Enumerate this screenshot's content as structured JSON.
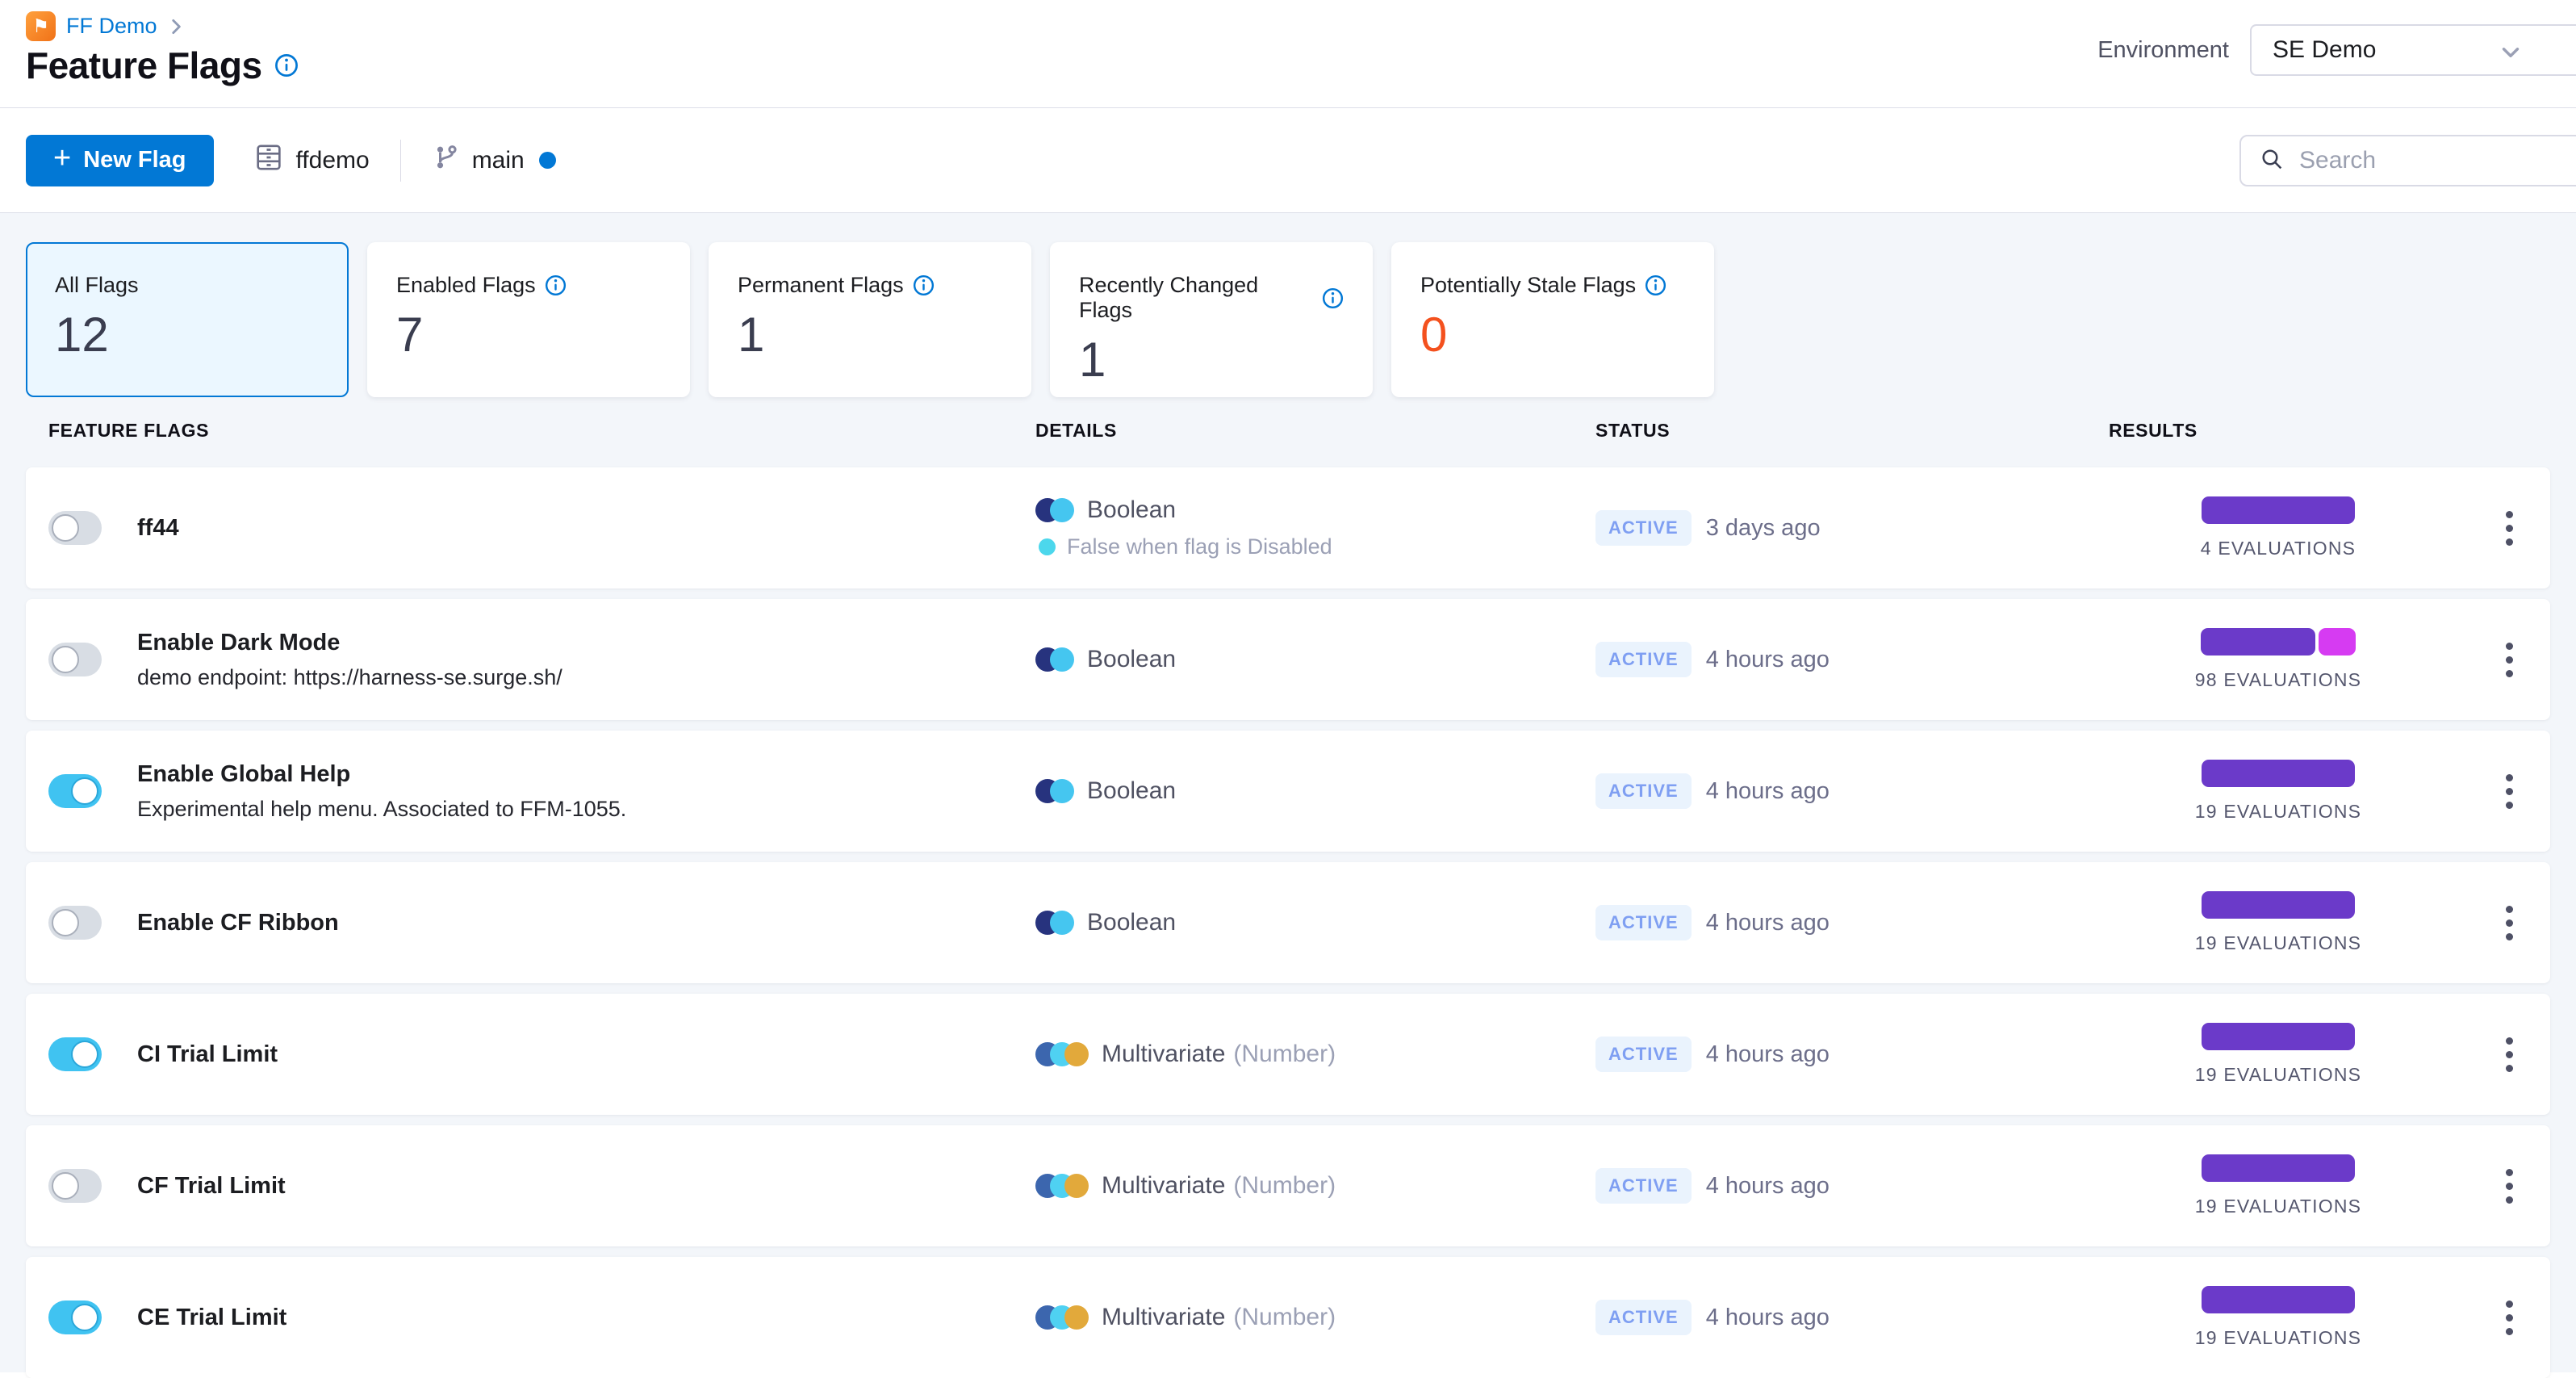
{
  "header": {
    "breadcrumb_label": "FF Demo",
    "title": "Feature Flags",
    "environment_label": "Environment",
    "environment_value": "SE Demo"
  },
  "toolbar": {
    "new_flag_plus": "+",
    "new_flag_label": "New Flag",
    "repository_name": "ffdemo",
    "branch_name": "main",
    "search_placeholder": "Search"
  },
  "summary_cards": [
    {
      "label": "All Flags",
      "value": "12",
      "info": false,
      "selected": true
    },
    {
      "label": "Enabled Flags",
      "value": "7",
      "info": true,
      "selected": false
    },
    {
      "label": "Permanent Flags",
      "value": "1",
      "info": true,
      "selected": false
    },
    {
      "label": "Recently Changed Flags",
      "value": "1",
      "info": true,
      "selected": false
    },
    {
      "label": "Potentially Stale Flags",
      "value": "0",
      "info": true,
      "selected": false,
      "value_color": "#F4511E"
    }
  ],
  "table": {
    "headers": [
      "FEATURE FLAGS",
      "DETAILS",
      "STATUS",
      "RESULTS"
    ],
    "rows": [
      {
        "name": "ff44",
        "description": "",
        "toggle": "off",
        "type_label": "Boolean",
        "type_kind": "boolean",
        "type_note": "",
        "variation_note": "False when flag is Disabled",
        "status": "ACTIVE",
        "updated": "3 days ago",
        "evaluations_label": "4 EVALUATIONS",
        "bar_segments": [
          {
            "color": "#6B3AC9",
            "width": 190
          }
        ]
      },
      {
        "name": "Enable Dark Mode",
        "description": "demo endpoint: https://harness-se.surge.sh/",
        "toggle": "off",
        "type_label": "Boolean",
        "type_kind": "boolean",
        "type_note": "",
        "variation_note": "",
        "status": "ACTIVE",
        "updated": "4 hours ago",
        "evaluations_label": "98 EVALUATIONS",
        "bar_segments": [
          {
            "color": "#6B3AC9",
            "width": 142
          },
          {
            "color": "#D63BF2",
            "width": 46
          }
        ]
      },
      {
        "name": "Enable Global Help",
        "description": "Experimental help menu. Associated to FFM-1055.",
        "toggle": "on",
        "type_label": "Boolean",
        "type_kind": "boolean",
        "type_note": "",
        "variation_note": "",
        "status": "ACTIVE",
        "updated": "4 hours ago",
        "evaluations_label": "19 EVALUATIONS",
        "bar_segments": [
          {
            "color": "#6B3AC9",
            "width": 190
          }
        ]
      },
      {
        "name": "Enable CF Ribbon",
        "description": "",
        "toggle": "off",
        "type_label": "Boolean",
        "type_kind": "boolean",
        "type_note": "",
        "variation_note": "",
        "status": "ACTIVE",
        "updated": "4 hours ago",
        "evaluations_label": "19 EVALUATIONS",
        "bar_segments": [
          {
            "color": "#6B3AC9",
            "width": 190
          }
        ]
      },
      {
        "name": "CI Trial Limit",
        "description": "",
        "toggle": "on",
        "type_label": "Multivariate",
        "type_kind": "multivariate",
        "type_note": "(Number)",
        "variation_note": "",
        "status": "ACTIVE",
        "updated": "4 hours ago",
        "evaluations_label": "19 EVALUATIONS",
        "bar_segments": [
          {
            "color": "#6B3AC9",
            "width": 190
          }
        ]
      },
      {
        "name": "CF Trial Limit",
        "description": "",
        "toggle": "off",
        "type_label": "Multivariate",
        "type_kind": "multivariate",
        "type_note": "(Number)",
        "variation_note": "",
        "status": "ACTIVE",
        "updated": "4 hours ago",
        "evaluations_label": "19 EVALUATIONS",
        "bar_segments": [
          {
            "color": "#6B3AC9",
            "width": 190
          }
        ]
      },
      {
        "name": "CE Trial Limit",
        "description": "",
        "toggle": "on",
        "type_label": "Multivariate",
        "type_kind": "multivariate",
        "type_note": "(Number)",
        "variation_note": "",
        "status": "ACTIVE",
        "updated": "4 hours ago",
        "evaluations_label": "19 EVALUATIONS",
        "bar_segments": [
          {
            "color": "#6B3AC9",
            "width": 190
          }
        ]
      }
    ]
  },
  "colors": {
    "primary_blue": "#0278D5",
    "toggle_on": "#40C3F1",
    "purple_bar": "#6B3AC9",
    "magenta_bar": "#D63BF2",
    "stale_orange": "#F4511E",
    "active_badge_text": "#7F9FF2",
    "active_badge_bg": "#EAF3FD",
    "boolean_icon": [
      "#27337E",
      "#45C6F0"
    ],
    "multivariate_icon": [
      "#3C66AE",
      "#4FD1F2",
      "#E2A93B"
    ],
    "variation_dot": "#4CD7EC"
  }
}
